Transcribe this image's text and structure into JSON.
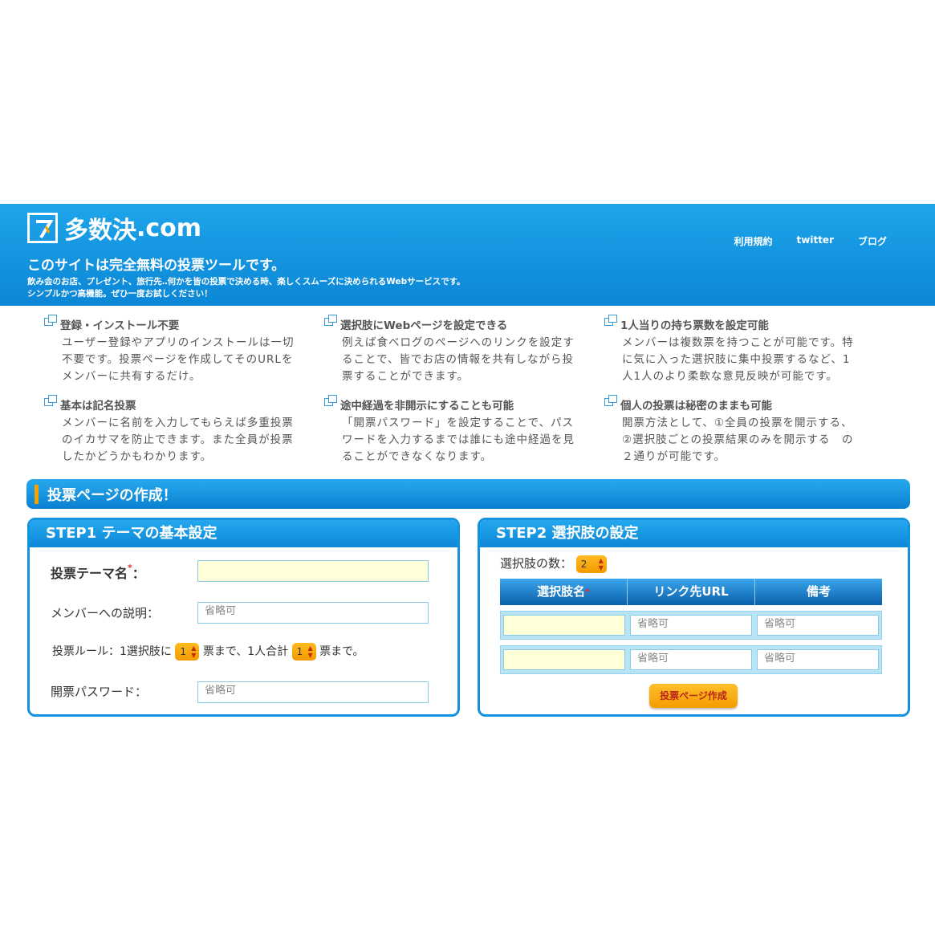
{
  "header": {
    "logo_text": "多数決",
    "logo_suffix": ".com",
    "tagline": "このサイトは完全無料の投票ツールです。",
    "subline1": "飲み会のお店、プレゼント、旅行先‥何かを皆の投票で決める時、楽しくスムーズに決められるWebサービスです。",
    "subline2": "シンプルかつ高機能。ぜひ一度お試しください！",
    "nav": [
      "利用規約",
      "twitter",
      "ブログ"
    ]
  },
  "features": [
    {
      "title": "登録・インストール不要",
      "body": "ユーザー登録やアプリのインストールは一切不要です。投票ページを作成してそのURLをメンバーに共有するだけ。"
    },
    {
      "title": "選択肢にWebページを設定できる",
      "body": "例えば食べログのページへのリンクを設定することで、皆でお店の情報を共有しながら投票することができます。"
    },
    {
      "title": "1人当りの持ち票数を設定可能",
      "body": "メンバーは複数票を持つことが可能です。特に気に入った選択肢に集中投票するなど、1人1人のより柔軟な意見反映が可能です。"
    },
    {
      "title": "基本は記名投票",
      "body": "メンバーに名前を入力してもらえば多重投票のイカサマを防止できます。また全員が投票したかどうかもわかります。"
    },
    {
      "title": "途中経過を非開示にすることも可能",
      "body": "「開票パスワード」を設定することで、パスワードを入力するまでは誰にも途中経過を見ることができなくなります。"
    },
    {
      "title": "個人の投票は秘密のままも可能",
      "body": "開票方法として、①全員の投票を開示する、②選択肢ごとの投票結果のみを開示する　の２通りが可能です。"
    }
  ],
  "section_title": "投票ページの作成！",
  "step1": {
    "title": "STEP1 テーマの基本設定",
    "theme_label": "投票テーマ名",
    "required_mark": "*",
    "colon": "：",
    "theme_value": "",
    "desc_label": "メンバーへの説明：",
    "desc_placeholder": "省略可",
    "rule_prefix": "投票ルール：1選択肢に",
    "rule_per_choice": "1",
    "rule_mid": "票まで、1人合計",
    "rule_total": "1",
    "rule_suffix": "票まで。",
    "password_label": "開票パスワード：",
    "password_placeholder": "省略可"
  },
  "step2": {
    "title": "STEP2 選択肢の設定",
    "count_label": "選択肢の数：",
    "count_value": "2",
    "columns": [
      "選択肢名",
      "リンク先URL",
      "備考"
    ],
    "rows": [
      {
        "name": "",
        "url_placeholder": "省略可",
        "note_placeholder": "省略可"
      },
      {
        "name": "",
        "url_placeholder": "省略可",
        "note_placeholder": "省略可"
      }
    ],
    "create_button": "投票ページ作成"
  },
  "colors": {
    "header_blue": "#0b86d6",
    "accent_orange": "#f4a200",
    "input_yellow": "#ffffd8"
  }
}
